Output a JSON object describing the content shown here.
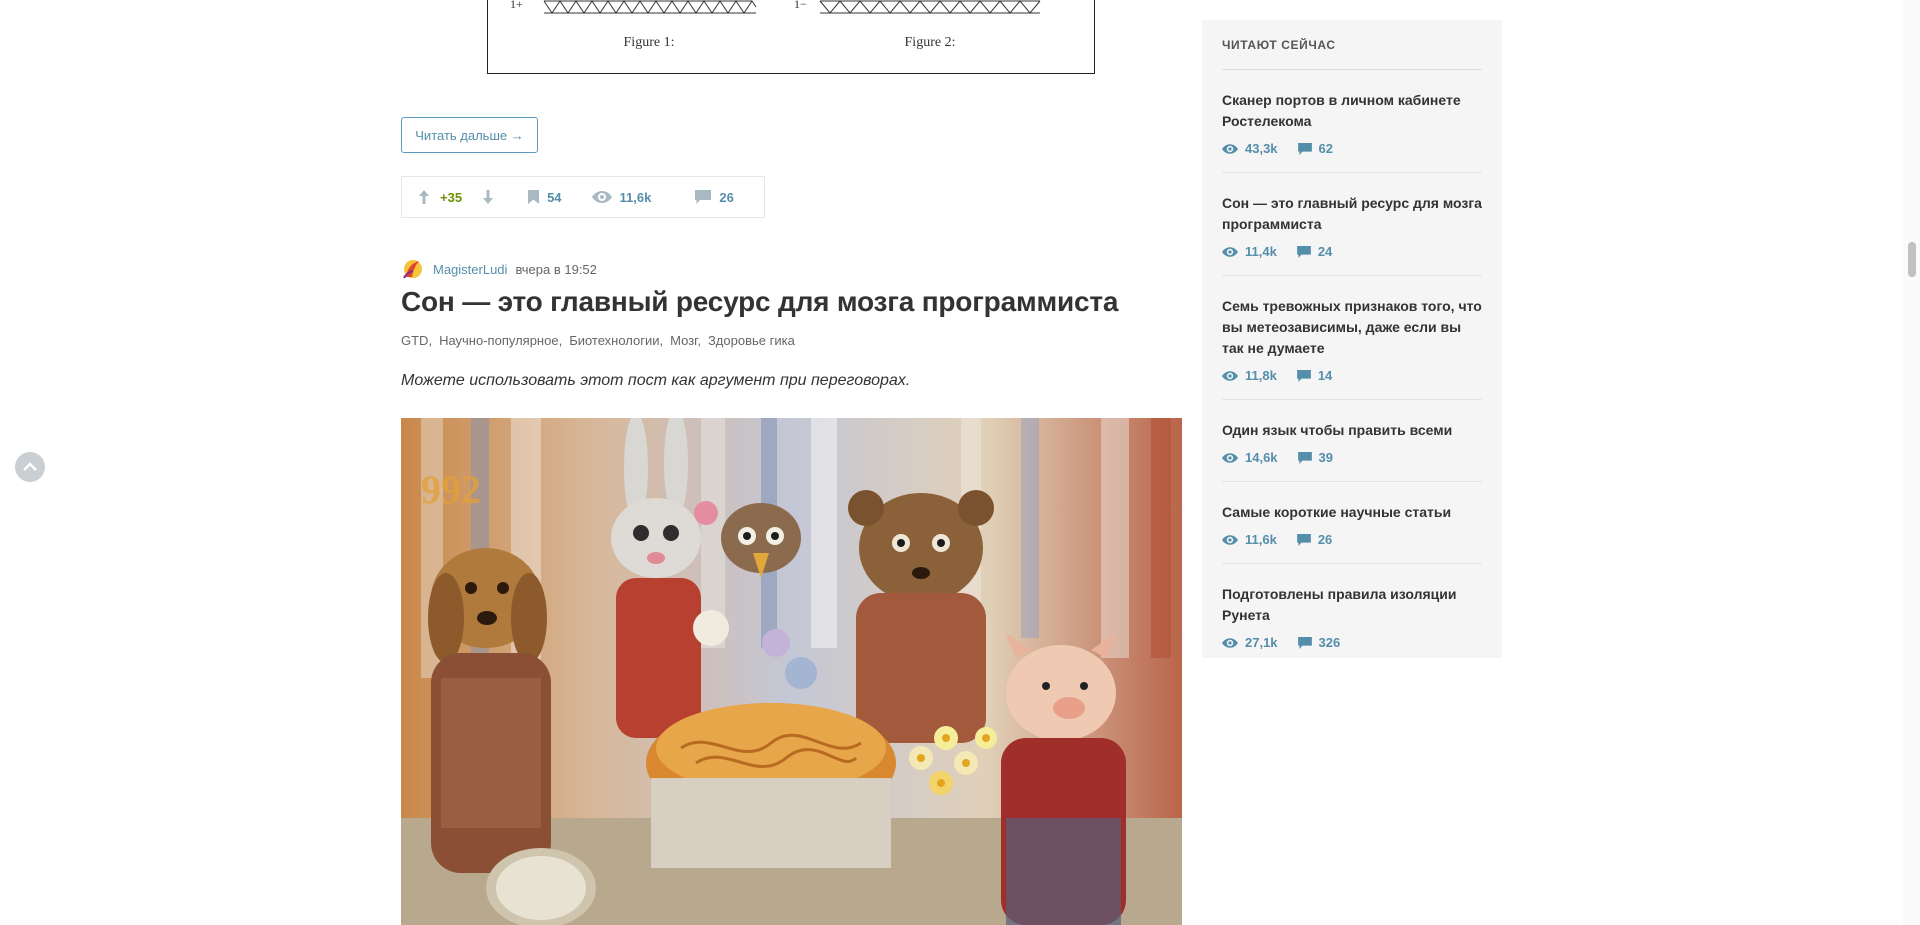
{
  "figure": {
    "caption1": "Figure 1:",
    "caption2": "Figure 2:"
  },
  "article_prev": {
    "read_more_label": "Читать дальше →",
    "score": "+35",
    "bookmarks": "54",
    "views": "11,6k",
    "comments": "26"
  },
  "post": {
    "author": "MagisterLudi",
    "time": "вчера в 19:52",
    "title": "Сон — это главный ресурс для мозга программиста",
    "hubs": [
      "GTD,",
      "Научно-популярное,",
      "Биотехнологии,",
      "Мозг,",
      "Здоровье гика"
    ],
    "lead": "Можете использовать этот пост как аргумент при переговорах."
  },
  "sidebar": {
    "title": "Читают сейчас",
    "items": [
      {
        "title": "Сканер портов в личном кабинете Ростелекома",
        "views": "43,3k",
        "comments": "62"
      },
      {
        "title": "Сон — это главный ресурс для мозга программиста",
        "views": "11,4k",
        "comments": "24"
      },
      {
        "title": "Семь тревожных признаков того, что вы метеозависимы, даже если вы так не думаете",
        "views": "11,8k",
        "comments": "14"
      },
      {
        "title": "Один язык чтобы править всеми",
        "views": "14,6k",
        "comments": "39"
      },
      {
        "title": "Самые короткие научные статьи",
        "views": "11,6k",
        "comments": "26"
      },
      {
        "title": "Подготовлены правила изоляции Рунета",
        "views": "27,1k",
        "comments": "326"
      }
    ]
  },
  "colors": {
    "link": "#548eaa",
    "score_positive": "#6c9007",
    "sidebar_bg": "#f5f5f5"
  }
}
